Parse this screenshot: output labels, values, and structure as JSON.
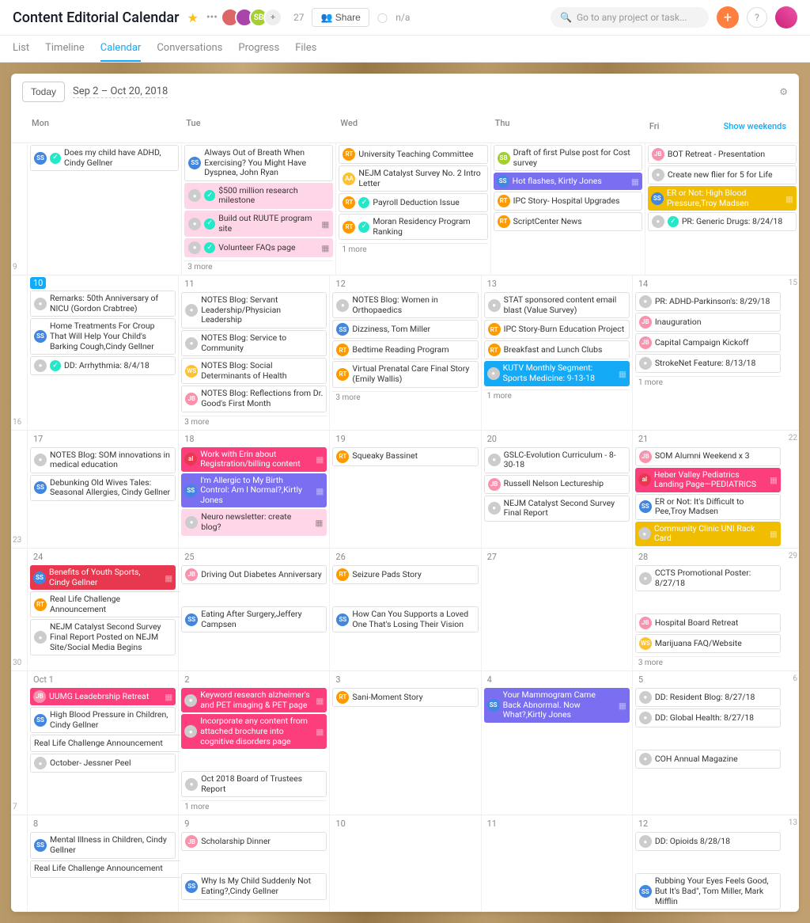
{
  "header": {
    "title": "Content Editorial Calendar",
    "member_count": "27",
    "share_label": "Share",
    "status": "n/a",
    "search_placeholder": "Go to any project or task..."
  },
  "nav": {
    "list": "List",
    "timeline": "Timeline",
    "calendar": "Calendar",
    "conversations": "Conversations",
    "progress": "Progress",
    "files": "Files"
  },
  "toolbar": {
    "today_label": "Today",
    "date_range": "Sep 2 – Oct 20, 2018"
  },
  "day_headers": {
    "mon": "Mon",
    "tue": "Tue",
    "wed": "Wed",
    "thu": "Thu",
    "fri": "Fri",
    "show_weekends": "Show weekends"
  },
  "weeks": [
    {
      "gutter_top": "",
      "gutter_bottom": "9",
      "cells": [
        {
          "date": "",
          "tasks": [
            {
              "avatar": "SS",
              "ac": "c-SS",
              "done": true,
              "text": "Does my child have ADHD, Cindy Gellner"
            }
          ]
        },
        {
          "date": "",
          "tasks": [
            {
              "avatar": "SS",
              "ac": "c-SS",
              "text": "Always Out of Breath When Exercising? You Might Have Dyspnea, John Ryan"
            },
            {
              "avatar": "●",
              "ac": "c-gray",
              "done": true,
              "text": "$500 million research milestone",
              "bg": "bg-pink-soft"
            },
            {
              "avatar": "●",
              "ac": "c-gray",
              "done": true,
              "text": "Build out RUUTE program site",
              "bg": "bg-pink-soft",
              "tag": true
            },
            {
              "avatar": "●",
              "ac": "c-gray",
              "done": true,
              "text": "Volunteer FAQs page",
              "bg": "bg-pink-soft",
              "tag": true
            }
          ],
          "more": "3 more"
        },
        {
          "date": "",
          "tasks": [
            {
              "avatar": "RT",
              "ac": "c-RT",
              "text": "University Teaching Committee"
            },
            {
              "avatar": "AA",
              "ac": "c-AA",
              "text": "NEJM Catalyst Survey No. 2 Intro Letter"
            },
            {
              "avatar": "RT",
              "ac": "c-RT",
              "done": true,
              "text": "Payroll Deduction Issue"
            },
            {
              "avatar": "RT",
              "ac": "c-RT",
              "done": true,
              "text": "Moran Residency Program Ranking"
            }
          ],
          "more": "1 more"
        },
        {
          "date": "",
          "tasks": [
            {
              "avatar": "SB",
              "ac": "c-SB",
              "text": "Draft of first Pulse post for Cost survey"
            },
            {
              "avatar": "SS",
              "ac": "c-SS",
              "text": "Hot flashes, Kirtly Jones",
              "bg": "bg-purple",
              "colored": true,
              "tag": true
            },
            {
              "avatar": "RT",
              "ac": "c-RT",
              "text": "IPC Story- Hospital Upgrades"
            },
            {
              "avatar": "RT",
              "ac": "c-RT",
              "text": "ScriptCenter News"
            }
          ]
        },
        {
          "date": "",
          "tasks": [
            {
              "avatar": "JB",
              "ac": "c-JB",
              "text": "BOT Retreat - Presentation"
            },
            {
              "avatar": "●",
              "ac": "c-gray",
              "text": "Create new flier for 5 for Life"
            },
            {
              "avatar": "SS",
              "ac": "c-SS",
              "text": "ER or Not: High Blood Pressure,Troy Madsen",
              "bg": "bg-yellow",
              "colored": true,
              "tag": true
            },
            {
              "avatar": "●",
              "ac": "c-gray",
              "done": true,
              "text": "PR: Generic Drugs: 8/24/18"
            }
          ]
        }
      ]
    },
    {
      "gutter_top": "",
      "gutter_bottom": "16",
      "cells": [
        {
          "date": "10",
          "today": true,
          "tasks": [
            {
              "avatar": "●",
              "ac": "c-gray",
              "text": "Remarks: 50th Anniversary of NICU (Gordon Crabtree)"
            },
            {
              "avatar": "SS",
              "ac": "c-SS",
              "text": "Home Treatments For Croup That Will Help Your Child's Barking Cough,Cindy Gellner"
            },
            {
              "avatar": "●",
              "ac": "c-gray",
              "done": true,
              "text": "DD: Arrhythmia: 8/4/18"
            }
          ]
        },
        {
          "date": "11",
          "tasks": [
            {
              "avatar": "●",
              "ac": "c-gray",
              "text": "NOTES Blog: Servant Leadership/Physician Leadership"
            },
            {
              "avatar": "●",
              "ac": "c-gray",
              "text": "NOTES Blog: Service to Community"
            },
            {
              "avatar": "WS",
              "ac": "c-WS",
              "text": "NOTES Blog: Social Determinants of Health"
            },
            {
              "avatar": "JB",
              "ac": "c-JB",
              "text": "NOTES Blog: Reflections from Dr. Good's First Month"
            }
          ],
          "more": "3 more"
        },
        {
          "date": "12",
          "tasks": [
            {
              "avatar": "●",
              "ac": "c-gray",
              "text": "NOTES Blog: Women in Orthopaedics"
            },
            {
              "avatar": "SS",
              "ac": "c-SS",
              "text": "Dizziness, Tom Miller"
            },
            {
              "avatar": "RT",
              "ac": "c-RT",
              "text": "Bedtime Reading Program"
            },
            {
              "avatar": "RT",
              "ac": "c-RT",
              "text": "Virtual Prenatal Care Final Story (Emily Wallis)"
            }
          ],
          "more": "3 more"
        },
        {
          "date": "13",
          "tasks": [
            {
              "avatar": "●",
              "ac": "c-gray",
              "text": "STAT sponsored content email blast (Value Survey)"
            },
            {
              "avatar": "RT",
              "ac": "c-RT",
              "text": "IPC Story-Burn Education Project"
            },
            {
              "avatar": "RT",
              "ac": "c-RT",
              "text": "Breakfast and Lunch Clubs"
            },
            {
              "avatar": "●",
              "ac": "c-gray",
              "text": "KUTV Monthly Segment: Sports Medicine: 9-13-18",
              "bg": "bg-blue",
              "colored": true,
              "tag": true
            }
          ],
          "more": "1 more"
        },
        {
          "date": "14",
          "tasks": [
            {
              "avatar": "●",
              "ac": "c-gray",
              "text": "PR: ADHD-Parkinson's: 8/29/18"
            },
            {
              "avatar": "JB",
              "ac": "c-JB",
              "text": "Inauguration"
            },
            {
              "avatar": "JB",
              "ac": "c-JB",
              "text": "Capital Campaign Kickoff"
            },
            {
              "avatar": "●",
              "ac": "c-gray",
              "text": "StrokeNet Feature: 8/13/18"
            }
          ],
          "more": "1 more"
        }
      ],
      "gutter_end": "15"
    },
    {
      "gutter_top": "",
      "gutter_bottom": "23",
      "cells": [
        {
          "date": "17",
          "tasks": [
            {
              "avatar": "●",
              "ac": "c-gray",
              "text": "NOTES Blog: SOM innovations in medical education"
            },
            {
              "avatar": "SS",
              "ac": "c-SS",
              "text": "Debunking Old Wives Tales: Seasonal Allergies, Cindy Gellner"
            }
          ]
        },
        {
          "date": "18",
          "tasks": [
            {
              "avatar": "al",
              "ac": "c-al",
              "text": "Work with Erin about Registration/billing content",
              "bg": "bg-pink",
              "colored": true,
              "tag": true
            },
            {
              "avatar": "SS",
              "ac": "c-SS",
              "text": "I'm Allergic to My Birth Control: Am I Normal?,Kirtly Jones",
              "bg": "bg-purple",
              "colored": true,
              "tag": true
            },
            {
              "avatar": "●",
              "ac": "c-gray",
              "text": "Neuro newsletter: create blog?",
              "bg": "bg-pink-soft",
              "tag": true
            }
          ]
        },
        {
          "date": "19",
          "tasks": [
            {
              "avatar": "RT",
              "ac": "c-RT",
              "text": "Squeaky Bassinet"
            }
          ]
        },
        {
          "date": "20",
          "tasks": [
            {
              "avatar": "●",
              "ac": "c-gray",
              "text": "GSLC-Evolution Curriculum - 8-30-18"
            },
            {
              "avatar": "JB",
              "ac": "c-JB",
              "text": "Russell Nelson Lectureship"
            },
            {
              "avatar": "●",
              "ac": "c-gray",
              "text": "NEJM Catalyst Second Survey Final Report"
            }
          ]
        },
        {
          "date": "21",
          "tasks": [
            {
              "avatar": "JB",
              "ac": "c-JB",
              "text": "SOM Alumni Weekend x 3"
            },
            {
              "avatar": "al",
              "ac": "c-al",
              "text": "Heber Valley Pediatrics Landing Page—PEDIATRICS",
              "bg": "bg-pink",
              "colored": true,
              "tag": true
            },
            {
              "avatar": "SS",
              "ac": "c-SS",
              "text": "ER or Not: It's Difficult to Pee,Troy Madsen"
            },
            {
              "avatar": "●",
              "ac": "c-gray",
              "text": "Community Clinic UNI Rack Card",
              "bg": "bg-yellow",
              "colored": true,
              "tag": true
            }
          ]
        }
      ],
      "gutter_end": "22"
    },
    {
      "gutter_top": "",
      "gutter_bottom": "30",
      "cells": [
        {
          "date": "24",
          "tasks": [
            {
              "avatar": "SS",
              "ac": "c-SS",
              "text": "Benefits of Youth Sports, Cindy Gellner",
              "bg": "bg-red",
              "colored": true,
              "tag": true
            },
            {
              "avatar": "RT",
              "ac": "c-RT",
              "text": "Real Life Challenge Announcement",
              "span": true
            },
            {
              "avatar": "●",
              "ac": "c-gray",
              "text": "NEJM Catalyst Second Survey Final Report Posted on NEJM Site/Social Media Begins"
            }
          ]
        },
        {
          "date": "25",
          "tasks": [
            {
              "avatar": "JB",
              "ac": "c-JB",
              "text": "Driving Out Diabetes Anniversary"
            },
            {
              "blank": true
            },
            {
              "avatar": "SS",
              "ac": "c-SS",
              "text": "Eating After Surgery,Jeffery Campsen"
            }
          ]
        },
        {
          "date": "26",
          "tasks": [
            {
              "avatar": "RT",
              "ac": "c-RT",
              "text": "Seizure Pads Story"
            },
            {
              "blank": true
            },
            {
              "avatar": "SS",
              "ac": "c-SS",
              "text": "How Can You Supports a Loved One That's Losing Their Vision"
            }
          ]
        },
        {
          "date": "27",
          "tasks": []
        },
        {
          "date": "28",
          "tasks": [
            {
              "avatar": "●",
              "ac": "c-gray",
              "text": "CCTS Promotional Poster: 8/27/18"
            },
            {
              "blank": true
            },
            {
              "avatar": "JB",
              "ac": "c-JB",
              "text": "Hospital Board Retreat"
            },
            {
              "avatar": "WS",
              "ac": "c-WS",
              "text": "Marijuana FAQ/Website"
            }
          ],
          "more": "3 more"
        }
      ],
      "gutter_end": "29"
    },
    {
      "gutter_top": "",
      "gutter_bottom": "7",
      "cells": [
        {
          "date": "Oct 1",
          "tasks": [
            {
              "avatar": "JB",
              "ac": "c-JB",
              "text": "UUMG Leadebrship Retreat",
              "bg": "bg-pink",
              "colored": true,
              "tag": true
            },
            {
              "avatar": "SS",
              "ac": "c-SS",
              "text": "High Blood Pressure in Children, Cindy Gellner"
            },
            {
              "avatar": "",
              "text": "Real Life Challenge Announcement",
              "span": true
            },
            {
              "avatar": "●",
              "ac": "c-gray",
              "text": "October- Jessner Peel"
            }
          ]
        },
        {
          "date": "2",
          "tasks": [
            {
              "avatar": "●",
              "ac": "c-gray",
              "text": "Keyword research alzheimer's and PET imaging & PET page",
              "bg": "bg-pink",
              "colored": true,
              "tag": true
            },
            {
              "avatar": "●",
              "ac": "c-gray",
              "text": "Incorporate any content from attached brochure into cognitive disorders page",
              "bg": "bg-pink",
              "colored": true,
              "tag": true
            },
            {
              "blank": true
            },
            {
              "avatar": "●",
              "ac": "c-gray",
              "text": "Oct 2018 Board of Trustees Report"
            }
          ],
          "more": "1 more"
        },
        {
          "date": "3",
          "tasks": [
            {
              "avatar": "RT",
              "ac": "c-RT",
              "text": "Sani-Moment Story"
            }
          ]
        },
        {
          "date": "4",
          "tasks": [
            {
              "avatar": "SS",
              "ac": "c-SS",
              "text": "Your Mammogram Came Back Abnormal. Now What?,Kirtly Jones",
              "bg": "bg-purple",
              "colored": true,
              "tag": true
            }
          ]
        },
        {
          "date": "5",
          "tasks": [
            {
              "avatar": "●",
              "ac": "c-gray",
              "text": "DD: Resident Blog: 8/27/18"
            },
            {
              "avatar": "●",
              "ac": "c-gray",
              "text": "DD: Global Health: 8/27/18"
            },
            {
              "blank": true
            },
            {
              "avatar": "●",
              "ac": "c-gray",
              "text": "COH Annual Magazine"
            }
          ]
        }
      ],
      "gutter_end": "6"
    },
    {
      "gutter_top": "",
      "gutter_bottom": "",
      "cells": [
        {
          "date": "8",
          "tasks": [
            {
              "avatar": "SS",
              "ac": "c-SS",
              "text": "Mental Illness in Children, Cindy Gellner"
            },
            {
              "avatar": "",
              "text": "Real Life Challenge Announcement",
              "span": true
            }
          ]
        },
        {
          "date": "9",
          "tasks": [
            {
              "avatar": "JB",
              "ac": "c-JB",
              "text": "Scholarship Dinner"
            },
            {
              "blank": true
            },
            {
              "avatar": "SS",
              "ac": "c-SS",
              "text": "Why Is My Child Suddenly Not Eating?,Cindy Gellner"
            }
          ]
        },
        {
          "date": "10",
          "tasks": []
        },
        {
          "date": "11",
          "tasks": []
        },
        {
          "date": "12",
          "tasks": [
            {
              "avatar": "●",
              "ac": "c-gray",
              "text": "DD: Opioids 8/28/18"
            },
            {
              "blank": true
            },
            {
              "avatar": "SS",
              "ac": "c-SS",
              "text": "Rubbing Your Eyes Feels Good, But It's Bad\", Tom Miller, Mark Mifflin"
            }
          ]
        }
      ],
      "gutter_end": "13"
    }
  ]
}
